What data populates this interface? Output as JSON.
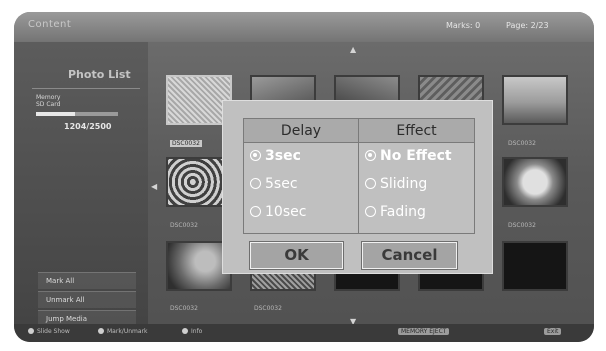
{
  "topbar": {
    "title": "Content",
    "marks": "Marks: 0",
    "page": "Page: 2/23"
  },
  "left_panel": {
    "title": "Photo List",
    "memory_line1": "Memory",
    "memory_line2": "SD Card",
    "count": "1204/2500",
    "usage_fraction": 0.48,
    "buttons": [
      "Mark All",
      "Unmark All",
      "Jump Media"
    ]
  },
  "thumbnails": {
    "captions": [
      "DSC0032",
      "DSC0032",
      "DSC0032",
      "DSC0032",
      "DSC0032",
      "DSC0032",
      "DSC0032",
      "DSC0032"
    ],
    "selected_caption": "DSC0032"
  },
  "bottombar": {
    "item1": "Slide Show",
    "item2": "Mark/Unmark",
    "item3": "Info",
    "badge": "MEMORY EJECT",
    "exit": "Exit"
  },
  "dialog": {
    "delay_header": "Delay",
    "effect_header": "Effect",
    "delay_options": [
      "3sec",
      "5sec",
      "10sec"
    ],
    "effect_options": [
      "No Effect",
      "Sliding",
      "Fading"
    ],
    "selected_delay": "3sec",
    "selected_effect": "No Effect",
    "ok_label": "OK",
    "cancel_label": "Cancel"
  }
}
